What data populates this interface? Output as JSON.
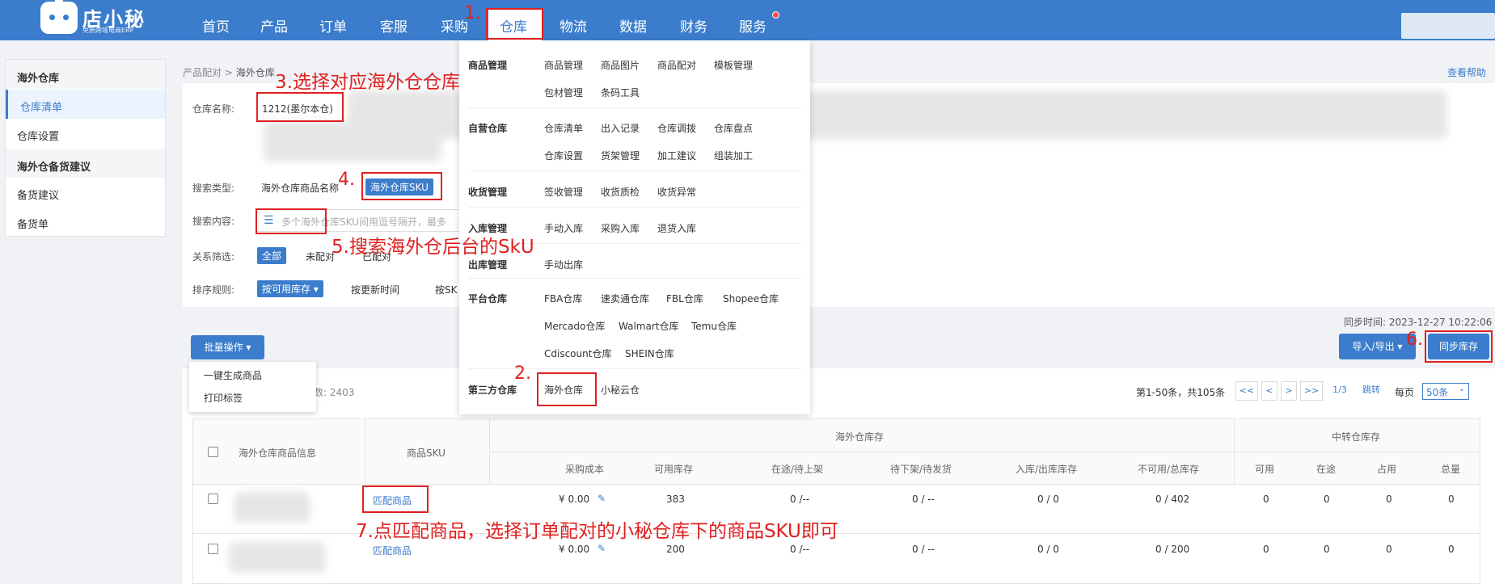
{
  "nav": {
    "logo_title": "店小秘",
    "logo_subtitle": "免费跨境电商ERP",
    "items": [
      "首页",
      "产品",
      "订单",
      "客服",
      "采购",
      "仓库",
      "物流",
      "数据",
      "财务",
      "服务"
    ],
    "active": "仓库"
  },
  "sidebar": {
    "section1": "海外仓库",
    "item_list": "仓库清单",
    "item_settings": "仓库设置",
    "section2": "海外仓备货建议",
    "item_suggest": "备货建议",
    "item_order": "备货单"
  },
  "breadcrumb": {
    "root": "产品配对",
    "sep": ">",
    "current": "海外仓库"
  },
  "help_link": "查看帮助",
  "filters": {
    "warehouse_label": "仓库名称:",
    "warehouse_value": "1212(墨尔本仓)",
    "search_type_label": "搜索类型:",
    "search_type_opt1": "海外仓库商品名称",
    "search_type_opt2": "海外仓库SKU",
    "search_content_label": "搜索内容:",
    "search_placeholder": "多个海外仓库SKU间用逗号隔开，最多",
    "relation_label": "关系筛选:",
    "relation_all": "全部",
    "relation_unmatched": "未配对",
    "relation_matched": "已配对",
    "sort_label": "排序规则:",
    "sort_opt1": "按可用库存 ▾",
    "sort_opt2": "按更新时间",
    "sort_opt3": "按SK"
  },
  "sync_time": "同步时间: 2023-12-27 10:22:06",
  "toolbar": {
    "batch_button": "批量操作 ▾",
    "batch_menu": [
      "一键生成商品",
      "打印标签"
    ],
    "total_count": "数: 2403",
    "import_export": "导入/导出 ▾",
    "sync_stock": "同步库存"
  },
  "pagination": {
    "summary": "第1-50条，共105条",
    "first": "<<",
    "prev": "<",
    "next": ">",
    "last": ">>",
    "page": "1/3",
    "jump": "跳转",
    "per_page_label": "每页",
    "per_page_value": "50条"
  },
  "menu": {
    "groups": [
      {
        "title": "商品管理",
        "rows": [
          [
            "商品管理",
            "商品图片",
            "商品配对",
            "模板管理"
          ],
          [
            "包材管理",
            "条码工具"
          ]
        ]
      },
      {
        "title": "自营仓库",
        "rows": [
          [
            "仓库清单",
            "出入记录",
            "仓库调拨",
            "仓库盘点"
          ],
          [
            "仓库设置",
            "货架管理",
            "加工建议",
            "组装加工"
          ]
        ]
      },
      {
        "title": "收货管理",
        "rows": [
          [
            "签收管理",
            "收货质检",
            "收货异常"
          ]
        ]
      },
      {
        "title": "入库管理",
        "rows": [
          [
            "手动入库",
            "采购入库",
            "退货入库"
          ]
        ]
      },
      {
        "title": "出库管理",
        "rows": [
          [
            "手动出库"
          ]
        ]
      },
      {
        "title": "平台仓库",
        "rows": [
          [
            "FBA仓库",
            "速卖通仓库",
            "FBL仓库",
            "Shopee仓库"
          ],
          [
            "Mercado仓库",
            "Walmart仓库",
            "Temu仓库"
          ],
          [
            "Cdiscount仓库",
            "SHEIN仓库"
          ]
        ]
      },
      {
        "title": "第三方仓库",
        "rows": [
          [
            "海外仓库",
            "小秘云仓"
          ]
        ]
      }
    ]
  },
  "table": {
    "group_overseas": "海外仓库存",
    "group_transit": "中转仓库存",
    "headers": [
      "海外仓库商品信息",
      "商品SKU",
      "采购成本",
      "可用库存",
      "在途/待上架",
      "待下架/待发货",
      "入库/出库库存",
      "不可用/总库存",
      "可用",
      "在途",
      "占用",
      "总量"
    ],
    "rows": [
      {
        "sku_link": "匹配商品",
        "cost": "¥ 0.00",
        "available": "383",
        "in_transit": "0 /--",
        "pending_out": "0 / --",
        "in_out": "0 / 0",
        "unusable_total": "0 / 402",
        "t_avail": "0",
        "t_transit": "0",
        "t_occupied": "0",
        "t_total": "0"
      },
      {
        "sku_link": "匹配商品",
        "cost": "¥ 0.00",
        "available": "200",
        "in_transit": "0 /--",
        "pending_out": "0 / --",
        "in_out": "0 / 0",
        "unusable_total": "0 / 200",
        "t_avail": "0",
        "t_transit": "0",
        "t_occupied": "0",
        "t_total": "0"
      }
    ]
  },
  "annotations": {
    "a1": "1.",
    "a2": "2.",
    "a3": "3.选择对应海外仓仓库",
    "a4": "4.",
    "a5": "5.搜索海外仓后台的SkU",
    "a6": "6.",
    "a7": "7.点匹配商品，选择订单配对的小秘仓库下的商品SKU即可"
  },
  "colors": {
    "primary": "#3b7dcc",
    "annotation": "#e02020",
    "badge": "#ff4d4f"
  },
  "icons": {
    "logo": "robot-logo-icon",
    "list": "list-icon",
    "edit": "edit-icon",
    "chevron": "chevron-down-icon"
  }
}
